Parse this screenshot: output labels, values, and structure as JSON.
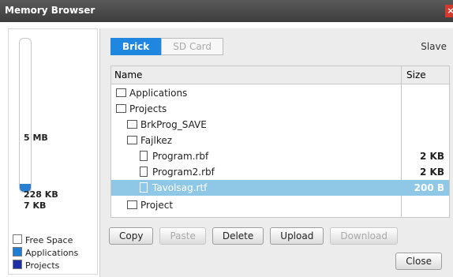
{
  "window": {
    "title": "Memory Browser",
    "close_icon": "close-icon"
  },
  "memory": {
    "labels": [
      "5 MB",
      "228 KB",
      "7 KB"
    ],
    "usage_fraction": 0.05,
    "legend": [
      {
        "label": "Free Space",
        "color": "#ffffff"
      },
      {
        "label": "Applications",
        "color": "#1f7ed6"
      },
      {
        "label": "Projects",
        "color": "#1c2ea8"
      }
    ]
  },
  "tabs": [
    {
      "label": "Brick",
      "active": true
    },
    {
      "label": "SD Card",
      "active": false
    }
  ],
  "device_label": "Slave",
  "table": {
    "headers": {
      "name": "Name",
      "size": "Size"
    },
    "rows": [
      {
        "name": "Applications",
        "size": "",
        "type": "folder",
        "indent": 0
      },
      {
        "name": "Projects",
        "size": "",
        "type": "folder-open",
        "indent": 0
      },
      {
        "name": "BrkProg_SAVE",
        "size": "",
        "type": "folder",
        "indent": 1
      },
      {
        "name": "Fajlkez",
        "size": "",
        "type": "folder-open",
        "indent": 1
      },
      {
        "name": "Program.rbf",
        "size": "2 KB",
        "type": "file",
        "indent": 2
      },
      {
        "name": "Program2.rbf",
        "size": "2 KB",
        "type": "file",
        "indent": 2
      },
      {
        "name": "Tavolsag.rtf",
        "size": "200 B",
        "type": "file",
        "indent": 2,
        "selected": true
      },
      {
        "name": "Project",
        "size": "",
        "type": "folder",
        "indent": 1
      }
    ]
  },
  "buttons": {
    "copy": "Copy",
    "paste": "Paste",
    "delete": "Delete",
    "upload": "Upload",
    "download": "Download",
    "close": "Close"
  }
}
